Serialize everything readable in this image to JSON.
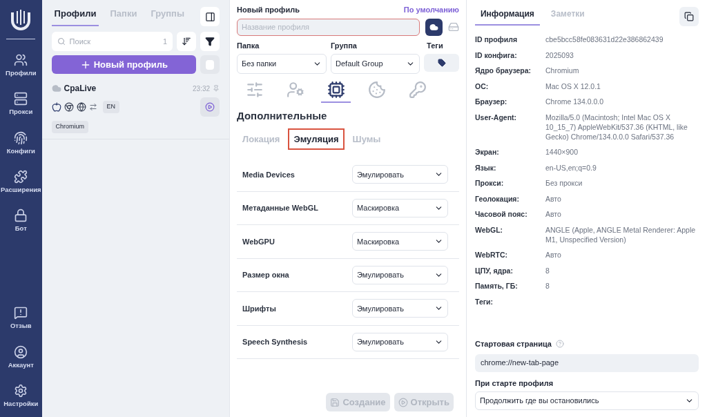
{
  "nav": {
    "top": [
      {
        "label": "Профили"
      },
      {
        "label": "Прокси"
      },
      {
        "label": "Конфиги"
      },
      {
        "label": "Расширения"
      },
      {
        "label": "Бот"
      }
    ],
    "bottom": [
      {
        "label": "Отзыв"
      },
      {
        "label": "Аккаунт"
      },
      {
        "label": "Настройки"
      }
    ]
  },
  "list_panel": {
    "tabs": [
      {
        "label": "Профили",
        "selected": true
      },
      {
        "label": "Папки",
        "selected": false
      },
      {
        "label": "Группы",
        "selected": false
      }
    ],
    "search": {
      "placeholder": "Поиск",
      "count": "1"
    },
    "new_button": "Новый профиль",
    "profiles": [
      {
        "name": "CpaLive",
        "time": "23:32",
        "language": "EN",
        "engine": "Chromium"
      }
    ]
  },
  "editor": {
    "title": "Новый профиль",
    "default_link": "По умолчанию",
    "name_field": {
      "placeholder": "Название профиля"
    },
    "folder": {
      "label": "Папка",
      "value": "Без папки"
    },
    "group": {
      "label": "Группа",
      "value": "Default Group"
    },
    "tags": {
      "label": "Теги"
    },
    "icon_tabs": [
      {
        "selected": false
      },
      {
        "selected": false
      },
      {
        "selected": true
      },
      {
        "selected": false
      },
      {
        "selected": false
      }
    ],
    "section_title": "Дополнительные",
    "sub_tabs": [
      {
        "label": "Локация",
        "selected": false
      },
      {
        "label": "Эмуляция",
        "selected": true
      },
      {
        "label": "Шумы",
        "selected": false
      }
    ],
    "settings": [
      {
        "label": "Media Devices",
        "value": "Эмулировать"
      },
      {
        "label": "Метаданные WebGL",
        "value": "Маскировка"
      },
      {
        "label": "WebGPU",
        "value": "Маскировка"
      },
      {
        "label": "Размер окна",
        "value": "Эмулировать"
      },
      {
        "label": "Шрифты",
        "value": "Эмулировать"
      },
      {
        "label": "Speech Synthesis",
        "value": "Эмулировать"
      }
    ],
    "buttons": [
      {
        "label": "Создание",
        "disabled": true
      },
      {
        "label": "Открыть",
        "disabled": true
      }
    ]
  },
  "info_panel": {
    "tabs": [
      {
        "label": "Информация",
        "selected": true
      },
      {
        "label": "Заметки",
        "selected": false
      }
    ],
    "rows": [
      {
        "label": "ID профиля",
        "value": "cbe5bcc58fe083631d22e386862439"
      },
      {
        "label": "ID конфига:",
        "value": "2025093"
      },
      {
        "label": "Ядро браузера:",
        "value": "Chromium"
      },
      {
        "label": "ОС:",
        "value": "Mac OS X 12.0.1"
      },
      {
        "label": "Браузер:",
        "value": "Chrome 134.0.0.0"
      },
      {
        "label": "User-Agent:",
        "value": "Mozilla/5.0 (Macintosh; Intel Mac OS X 10_15_7) AppleWebKit/537.36 (KHTML, like Gecko) Chrome/134.0.0.0 Safari/537.36"
      },
      {
        "label": "Экран:",
        "value": "1440×900"
      },
      {
        "label": "Язык:",
        "value": "en-US,en;q=0.9"
      },
      {
        "label": "Прокси:",
        "value": "Без прокси"
      },
      {
        "label": "Геолокация:",
        "value": "Авто"
      },
      {
        "label": "Часовой пояс:",
        "value": "Авто"
      },
      {
        "label": "WebGL:",
        "value": "ANGLE (Apple, ANGLE Metal Renderer: Apple M1, Unspecified Version)"
      },
      {
        "label": "WebRTC:",
        "value": "Авто"
      },
      {
        "label": "ЦПУ, ядра:",
        "value": "8"
      },
      {
        "label": "Память, ГБ:",
        "value": "8"
      },
      {
        "label": "Теги:",
        "value": ""
      }
    ],
    "start_page": {
      "label": "Стартовая страница",
      "value": "chrome://new-tab-page"
    },
    "on_start": {
      "label": "При старте профиля",
      "value": "Продолжить где вы остановились"
    }
  }
}
